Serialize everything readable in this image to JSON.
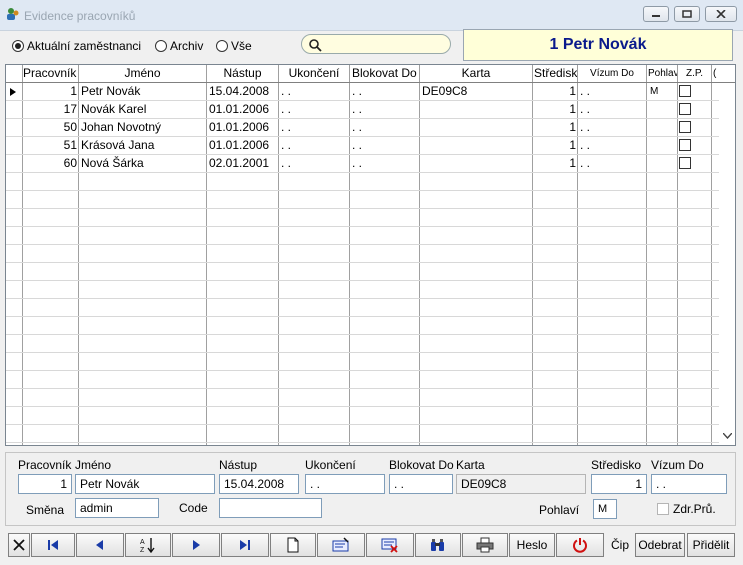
{
  "window": {
    "title": "Evidence pracovníků",
    "controls": [
      "minimize-icon",
      "restore-icon",
      "close-icon"
    ]
  },
  "filter": {
    "options": [
      {
        "label": "Aktuální zaměstnanci",
        "selected": true
      },
      {
        "label": "Archiv",
        "selected": false
      },
      {
        "label": "Vše",
        "selected": false
      }
    ],
    "search_value": ""
  },
  "current_record_display": "1 Petr Novák",
  "table": {
    "columns": [
      "Pracovník",
      "Jméno",
      "Nástup",
      "Ukončení",
      "Blokovat Do",
      "Karta",
      "Středisk",
      "Vízum Do",
      "Pohlav",
      "Z.P.",
      "("
    ],
    "rows": [
      {
        "pracovnik": "1",
        "jmeno": "Petr Novák",
        "nastup": "15.04.2008",
        "ukonceni": ". .",
        "blokovat": ". .",
        "karta": "DE09C8",
        "stredisko": "1",
        "vizum": ". .",
        "pohlavi": "M",
        "zp": false,
        "current": true
      },
      {
        "pracovnik": "17",
        "jmeno": "Novák Karel",
        "nastup": "01.01.2006",
        "ukonceni": ". .",
        "blokovat": ". .",
        "karta": "",
        "stredisko": "1",
        "vizum": ". .",
        "pohlavi": "",
        "zp": false,
        "current": false
      },
      {
        "pracovnik": "50",
        "jmeno": "Johan Novotný",
        "nastup": "01.01.2006",
        "ukonceni": ". .",
        "blokovat": ". .",
        "karta": "",
        "stredisko": "1",
        "vizum": ". .",
        "pohlavi": "",
        "zp": false,
        "current": false
      },
      {
        "pracovnik": "51",
        "jmeno": "Krásová Jana",
        "nastup": "01.01.2006",
        "ukonceni": ". .",
        "blokovat": ". .",
        "karta": "",
        "stredisko": "1",
        "vizum": ". .",
        "pohlavi": "",
        "zp": false,
        "current": false
      },
      {
        "pracovnik": "60",
        "jmeno": "Nová Šárka",
        "nastup": "02.01.2001",
        "ukonceni": ". .",
        "blokovat": ". .",
        "karta": "",
        "stredisko": "1",
        "vizum": ". .",
        "pohlavi": "",
        "zp": false,
        "current": false
      }
    ]
  },
  "detail": {
    "labels": {
      "pracovnik": "Pracovník",
      "jmeno": "Jméno",
      "nastup": "Nástup",
      "ukonceni": "Ukončení",
      "blokovat": "Blokovat Do",
      "karta": "Karta",
      "stredisko": "Středisko",
      "vizum": "Vízum Do",
      "smena": "Směna",
      "code": "Code",
      "pohlavi": "Pohlaví",
      "zdrpru": "Zdr.Prů."
    },
    "values": {
      "pracovnik": "1",
      "jmeno": "Petr Novák",
      "nastup": "15.04.2008",
      "ukonceni": ". .",
      "blokovat": ". .",
      "karta": "DE09C8",
      "stredisko": "1",
      "vizum": ". .",
      "smena": "admin",
      "code": "",
      "pohlavi": "M",
      "zdrpru": false
    }
  },
  "toolbar": {
    "buttons": [
      "close-x-icon",
      "first-record-icon",
      "previous-record-icon",
      "sort-az-icon",
      "next-record-icon",
      "last-record-icon",
      "new-document-icon",
      "edit-card-icon",
      "delete-card-icon",
      "find-binoculars-icon",
      "print-icon"
    ],
    "heslo_label": "Heslo",
    "power": "power-icon",
    "cip_label": "Čip",
    "odebrat_label": "Odebrat",
    "pridelit_label": "Přidělit"
  }
}
